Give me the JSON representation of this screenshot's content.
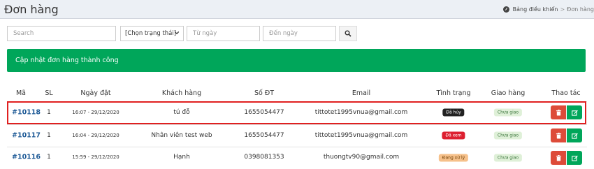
{
  "header": {
    "title": "Đơn hàng",
    "breadcrumb": [
      "Bảng điều khiển",
      "Đơn hàng"
    ],
    "breadcrumb_sep": ">"
  },
  "filters": {
    "search_placeholder": "Search",
    "status_value": "[Chọn trạng thái]",
    "from_placeholder": "Từ ngày",
    "to_placeholder": "Đến ngày"
  },
  "alert": {
    "text": "Cập nhật đơn hàng thành công",
    "color": "#00a65a"
  },
  "table": {
    "headers": [
      "Mã",
      "SL",
      "Ngày đặt",
      "Khách hàng",
      "Số ĐT",
      "Email",
      "Tình trạng",
      "Giao hàng",
      "Thao tác"
    ],
    "rows": [
      {
        "id": "#10118",
        "qty": "1",
        "date": "16:07 - 29/12/2020",
        "customer": "tú đỗ",
        "phone": "1655054477",
        "email": "tittotet1995vnua@gmail.com",
        "status": "Đã hủy",
        "shipping": "Chưa giao"
      },
      {
        "id": "#10117",
        "qty": "1",
        "date": "16:04 - 29/12/2020",
        "customer": "Nhân viên test web",
        "phone": "1655054477",
        "email": "tittotet1995vnua@gmail.com",
        "status": "Đã xem",
        "shipping": "Chưa giao"
      },
      {
        "id": "#10116",
        "qty": "1",
        "date": "15:59 - 29/12/2020",
        "customer": "Hạnh",
        "phone": "0398081353",
        "email": "thuongtv90@gmail.com",
        "status": "Đang xử lý",
        "shipping": "Chưa giao"
      }
    ]
  },
  "icons": {
    "breadcrumb": "dashboard-icon",
    "search_button": "search-icon",
    "delete": "trash-icon",
    "edit": "edit-icon"
  }
}
